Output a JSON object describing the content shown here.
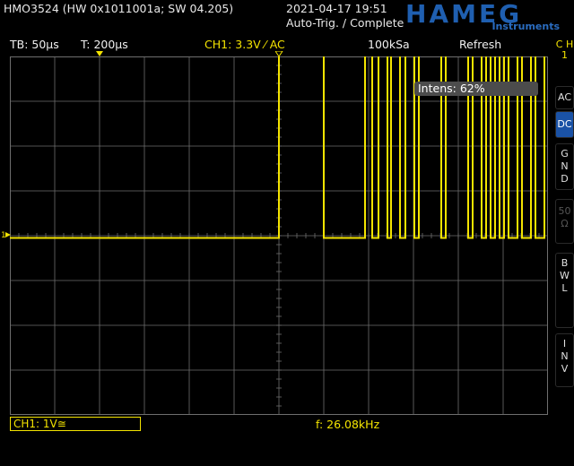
{
  "header": {
    "device_info": "HMO3524 (HW 0x1011001a; SW 04.205)",
    "datetime": "2021-04-17 19:51",
    "trigger_status": "Auto-Trig. / Complete",
    "logo": "HAMEG",
    "logo_sub": "Instruments"
  },
  "status_bar": {
    "timebase": "TB: 50µs",
    "trigger_time": "T: 200µs",
    "channel_setting": "CH1: 3.3V ⁄ AC",
    "sample_rate": "100kSa",
    "mode": "Refresh"
  },
  "side_menu": {
    "channel_label": [
      "C",
      "H",
      "1"
    ],
    "ac": "AC",
    "dc": "DC",
    "gnd": [
      "G",
      "N",
      "D"
    ],
    "fifty_ohm": [
      "50",
      "Ω"
    ],
    "bwl": [
      "B",
      "W",
      "L"
    ],
    "inv": [
      "I",
      "N",
      "V"
    ]
  },
  "intensity_popup": "Intens: 62%",
  "bottom": {
    "channel_box": "CH1: 1V≅",
    "frequency": "f: 26.08kHz"
  },
  "colors": {
    "trace": "#f4e400",
    "accent": "#1a52a6",
    "grid": "#6e6e6e"
  },
  "waveform": {
    "low_level_div": -0.05,
    "high_level_div": 4.1,
    "transitions_time_div": [
      0,
      1.0,
      1.92,
      2.08,
      2.22,
      2.42,
      2.5,
      2.7,
      2.82,
      3.02,
      3.12,
      3.62,
      3.72,
      4.22,
      4.32,
      4.52,
      4.62,
      4.72,
      4.82,
      4.92,
      5.02,
      5.12,
      5.32,
      5.42,
      5.62,
      5.72,
      5.92
    ]
  }
}
